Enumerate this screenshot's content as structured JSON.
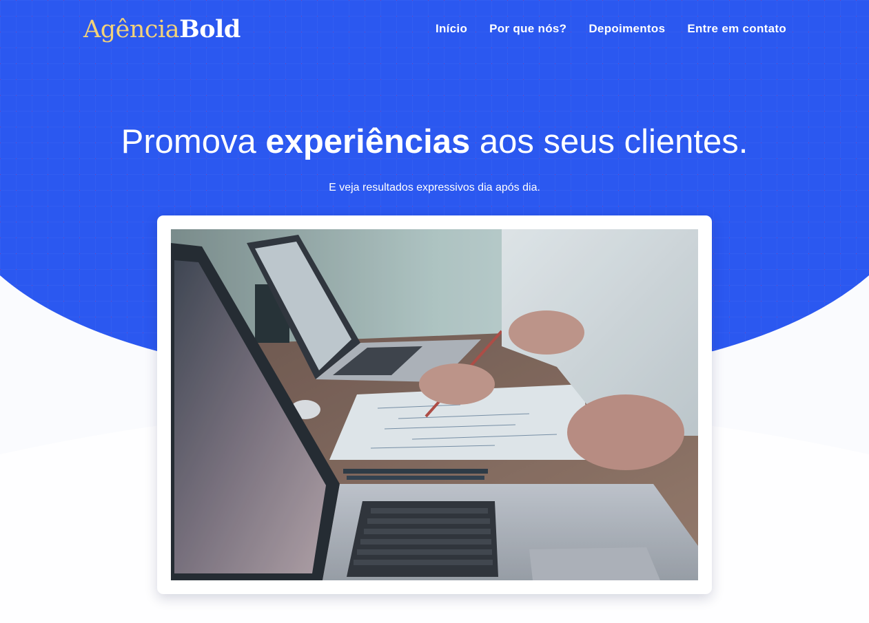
{
  "brand": {
    "logo_light": "Agência",
    "logo_bold": "Bold"
  },
  "nav": {
    "items": [
      {
        "label": "Início"
      },
      {
        "label": "Por que nós?"
      },
      {
        "label": "Depoimentos"
      },
      {
        "label": "Entre em contato"
      }
    ]
  },
  "hero": {
    "headline_pre": "Promova ",
    "headline_bold": "experiências",
    "headline_post": " aos seus clientes.",
    "subheadline": "E veja resultados expressivos dia após dia."
  },
  "colors": {
    "hero_blue": "#2b58f0",
    "logo_gold": "#f2d27a",
    "page_bg": "#fafbfe"
  },
  "icons": {
    "hero_photo": "office-meeting-laptops-photo"
  }
}
